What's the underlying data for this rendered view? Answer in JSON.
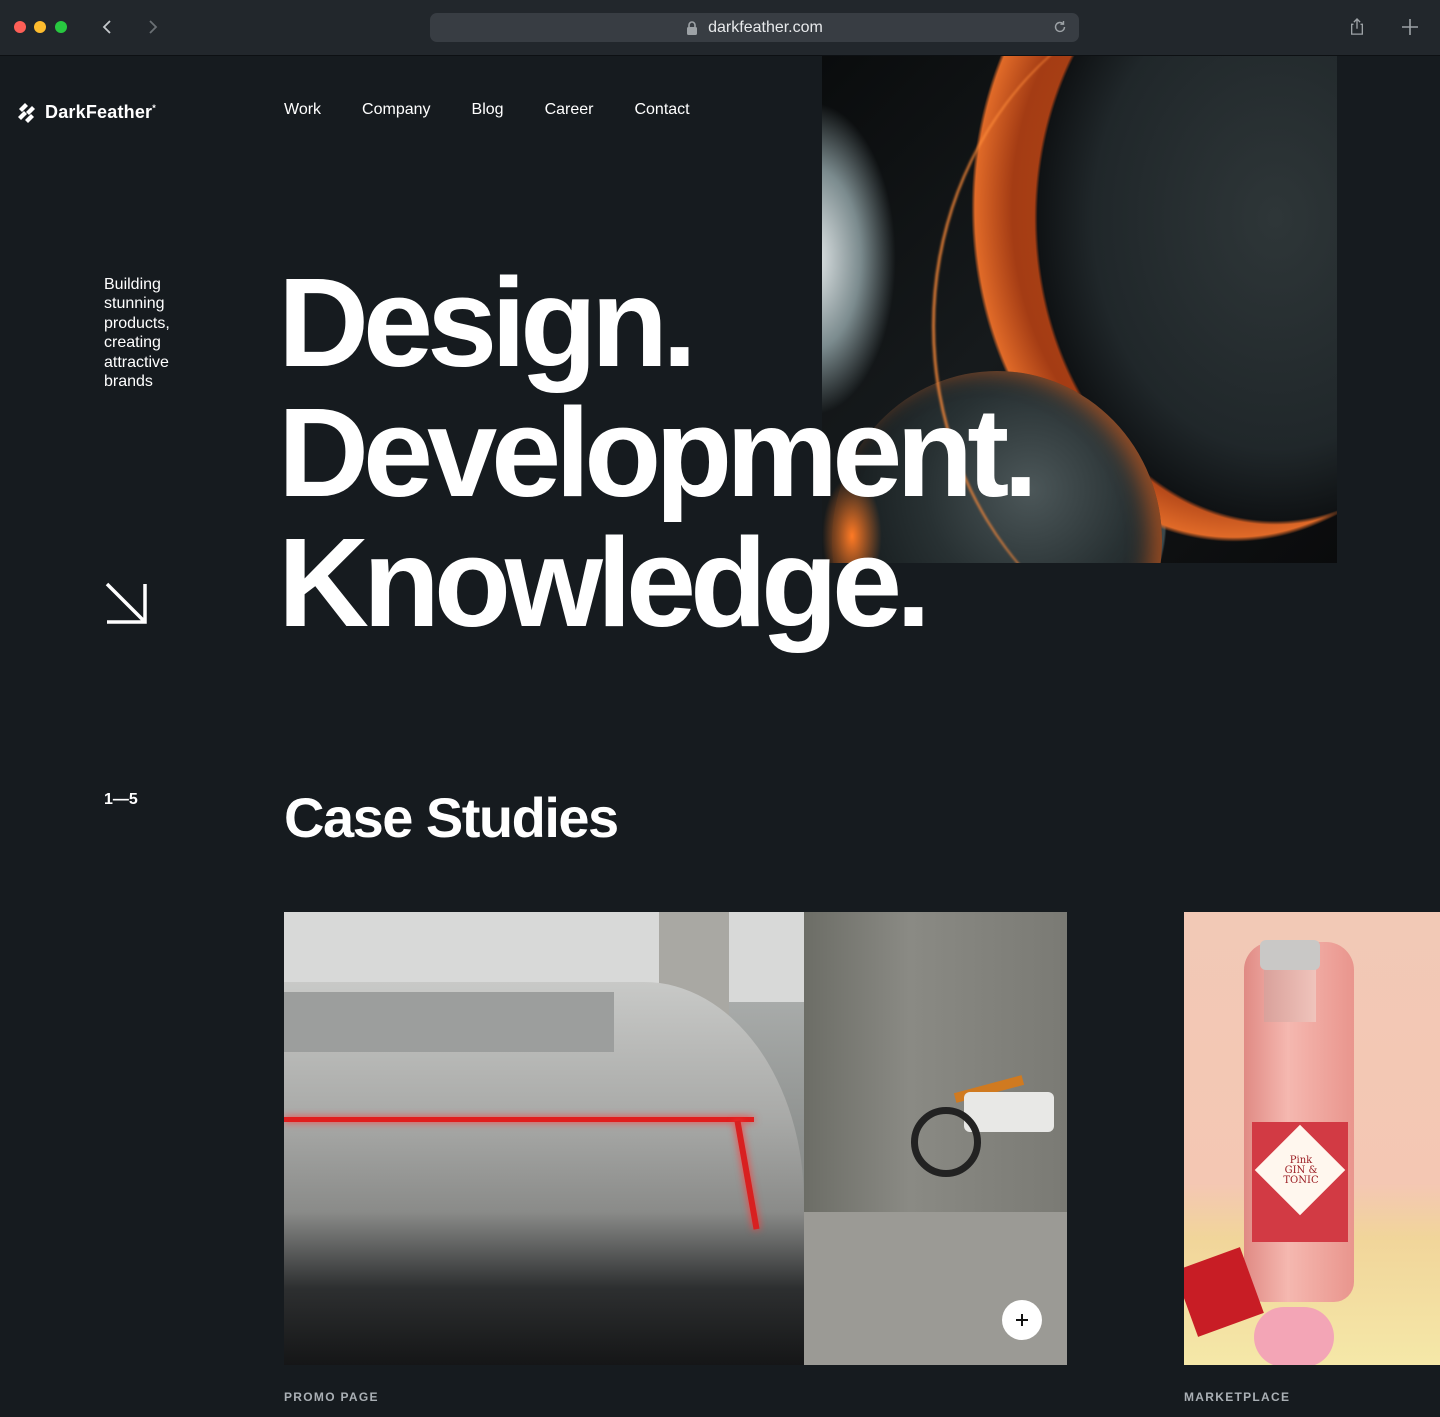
{
  "browser": {
    "url": "darkfeather.com"
  },
  "brand": {
    "name": "DarkFeather",
    "mark": "*"
  },
  "nav": {
    "items": [
      "Work",
      "Company",
      "Blog",
      "Career",
      "Contact"
    ]
  },
  "hero": {
    "tagline": "Building stunning products, creating attractive brands",
    "lines": [
      "Design.",
      "Development.",
      "Knowledge."
    ]
  },
  "case_studies": {
    "counter": "1—5",
    "title": "Case Studies",
    "cards": [
      {
        "category": "PROMO PAGE",
        "image": "car-showroom-photo"
      },
      {
        "category": "MARKETPLACE",
        "image": "pink-gin-tonic-bottle-photo",
        "product_label": "Pink GIN & TONIC"
      }
    ]
  },
  "icons": {
    "back": "chevron-left-icon",
    "forward": "chevron-right-icon",
    "lock": "lock-icon",
    "reload": "reload-icon",
    "share": "share-icon",
    "new_tab": "plus-icon",
    "hero_arrow": "arrow-down-right-icon",
    "card_expand": "plus-icon"
  },
  "colors": {
    "background": "#161b1f",
    "chrome": "#22272c",
    "text": "#ffffff",
    "muted": "#aab0b5"
  }
}
